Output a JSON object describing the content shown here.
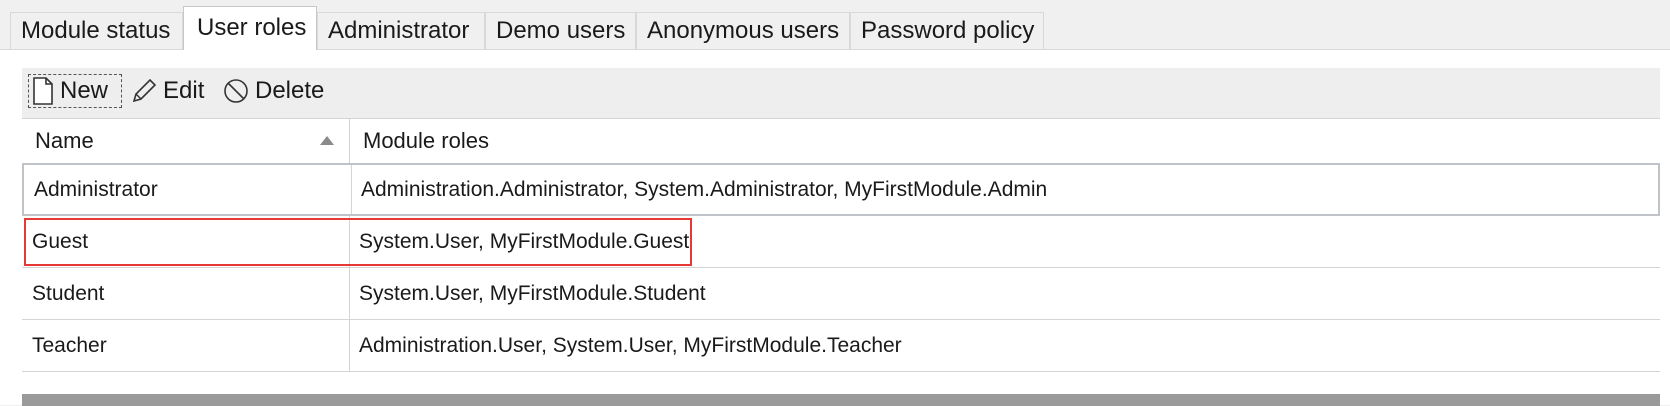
{
  "tabs": [
    {
      "label": "Module status",
      "active": false
    },
    {
      "label": "User roles",
      "active": true
    },
    {
      "label": "Administrator",
      "active": false
    },
    {
      "label": "Demo users",
      "active": false
    },
    {
      "label": "Anonymous users",
      "active": false
    },
    {
      "label": "Password policy",
      "active": false
    }
  ],
  "toolbar": {
    "new_label": "New",
    "edit_label": "Edit",
    "delete_label": "Delete",
    "icons": {
      "new": "new-document-icon",
      "edit": "pencil-icon",
      "delete": "prohibited-icon"
    }
  },
  "grid": {
    "columns": [
      "Name",
      "Module roles"
    ],
    "sort": {
      "column": "Name",
      "direction": "ascending"
    },
    "rows": [
      {
        "name": "Administrator",
        "roles": "Administration.Administrator, System.Administrator, MyFirstModule.Admin",
        "selected": true
      },
      {
        "name": "Guest",
        "roles": "System.User, MyFirstModule.Guest",
        "highlighted": true
      },
      {
        "name": "Student",
        "roles": "System.User, MyFirstModule.Student"
      },
      {
        "name": "Teacher",
        "roles": "Administration.User, System.User, MyFirstModule.Teacher"
      }
    ]
  },
  "colors": {
    "highlight": "#e53935",
    "background": "#f0f0f0",
    "grid_footer": "#9a9a9a"
  }
}
